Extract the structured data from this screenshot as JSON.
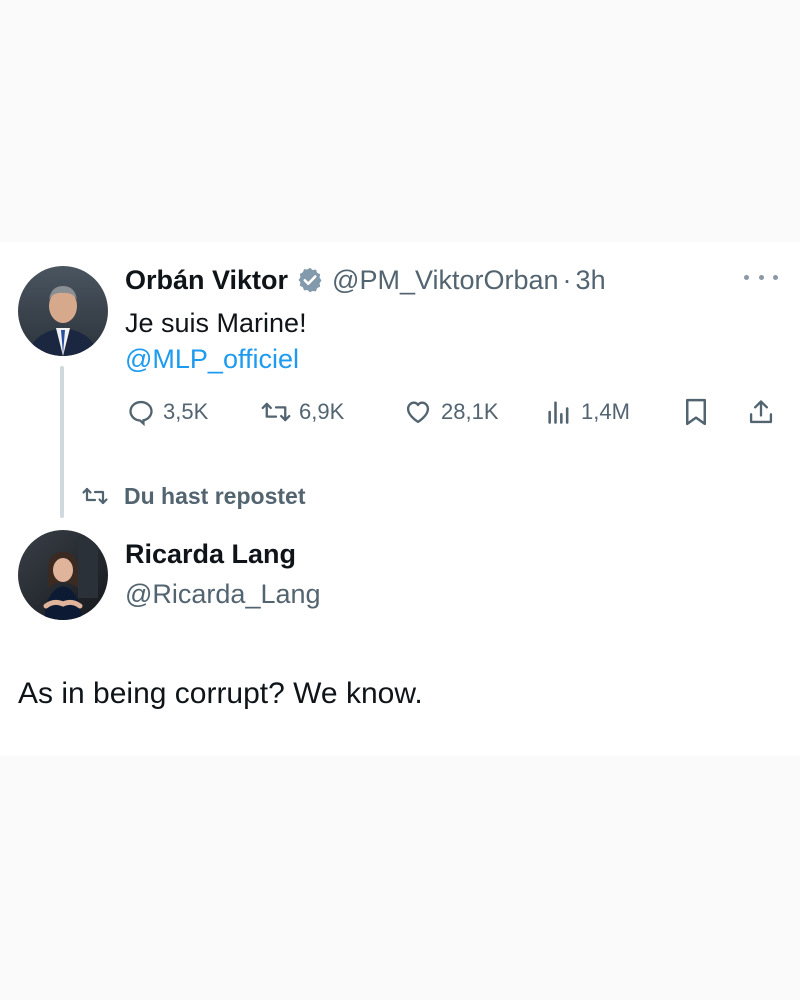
{
  "tweet": {
    "author_name": "Orbán Viktor",
    "author_handle": "@PM_ViktorOrban",
    "separator": "·",
    "time": "3h",
    "text": "Je suis Marine!",
    "mention": "@MLP_officiel",
    "stats": {
      "replies": "3,5K",
      "reposts": "6,9K",
      "likes": "28,1K",
      "views": "1,4M"
    },
    "icons": [
      "verified-badge-icon",
      "more-options-icon",
      "reply-icon",
      "repost-icon",
      "like-icon",
      "views-icon",
      "bookmark-icon",
      "share-icon"
    ]
  },
  "repost_context": {
    "label": "Du hast repostet"
  },
  "quoted": {
    "author_name": "Ricarda Lang",
    "author_handle": "@Ricarda_Lang",
    "text": "As in being corrupt? We know."
  },
  "colors": {
    "accent": "#1d9bf0",
    "secondary_text": "#536471",
    "primary_text": "#0f1419",
    "background": "#fafafa"
  }
}
